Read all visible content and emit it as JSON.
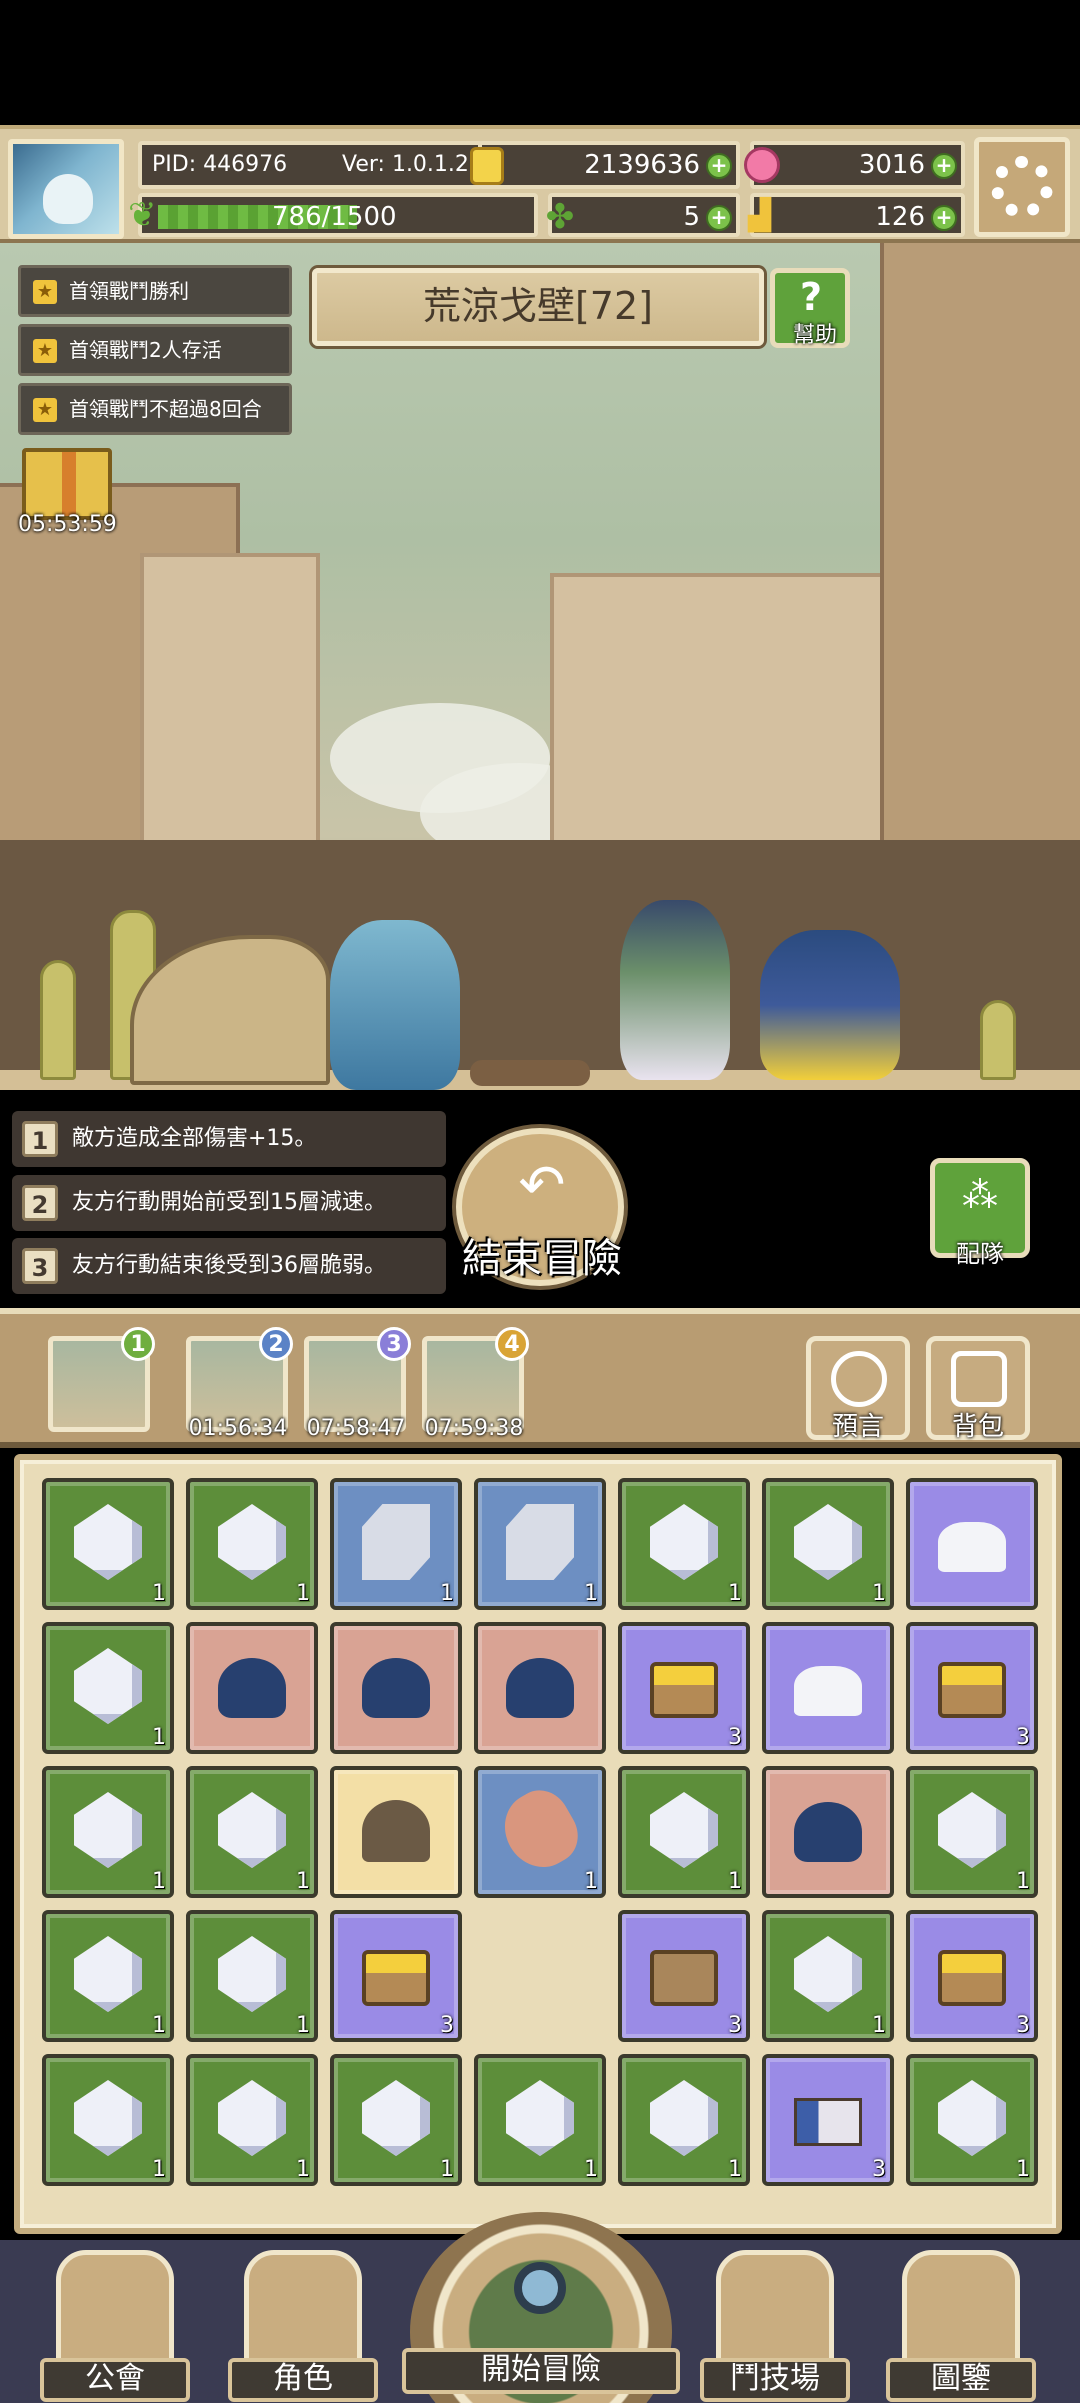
{
  "header": {
    "pid": "PID: 446976",
    "version": "Ver: 1.0.1.2",
    "gold": "2139636",
    "gems": "3016",
    "exp": "786/1500",
    "exp_fraction": 0.524,
    "clovers": "5",
    "shoes": "126"
  },
  "quests": [
    {
      "label": "首領戰鬥勝利"
    },
    {
      "label": "首領戰鬥2人存活"
    },
    {
      "label": "首領戰鬥不超過8回合"
    }
  ],
  "gift": {
    "timer": "05:53:59"
  },
  "stage": {
    "title": "荒涼戈壁[72]",
    "help_label": "幫助"
  },
  "effects": [
    {
      "num": "1",
      "text": "敵方造成全部傷害+15。"
    },
    {
      "num": "2",
      "text": "友方行動開始前受到15層減速。"
    },
    {
      "num": "3",
      "text": "友方行動結束後受到36層脆弱。"
    }
  ],
  "end_button": {
    "label": "結束冒險"
  },
  "team_button": {
    "label": "配隊"
  },
  "slots": [
    {
      "num": "1",
      "time": "",
      "color": "#6fae3f"
    },
    {
      "num": "2",
      "time": "01:56:34",
      "color": "#5b82c6"
    },
    {
      "num": "3",
      "time": "07:58:47",
      "color": "#8a7ed8"
    },
    {
      "num": "4",
      "time": "07:59:38",
      "color": "#d9a436"
    }
  ],
  "side_buttons": {
    "prophecy": "預言",
    "backpack": "背包"
  },
  "inventory": [
    {
      "type": "crystal",
      "rarity": "green",
      "qty": "1"
    },
    {
      "type": "crystal",
      "rarity": "green",
      "qty": "1"
    },
    {
      "type": "cube",
      "rarity": "blue",
      "qty": "1"
    },
    {
      "type": "cube",
      "rarity": "blue",
      "qty": "1"
    },
    {
      "type": "crystal",
      "rarity": "green",
      "qty": "1"
    },
    {
      "type": "crystal",
      "rarity": "green",
      "qty": "1"
    },
    {
      "type": "ore",
      "rarity": "purple",
      "qty": ""
    },
    {
      "type": "crystal",
      "rarity": "green",
      "qty": "1"
    },
    {
      "type": "slime",
      "rarity": "pink",
      "qty": ""
    },
    {
      "type": "slime",
      "rarity": "pink",
      "qty": ""
    },
    {
      "type": "slime",
      "rarity": "pink",
      "qty": ""
    },
    {
      "type": "gold-chest",
      "rarity": "purple",
      "qty": "3"
    },
    {
      "type": "ore",
      "rarity": "purple",
      "qty": ""
    },
    {
      "type": "gold-chest",
      "rarity": "purple",
      "qty": "3"
    },
    {
      "type": "crystal",
      "rarity": "green",
      "qty": "1"
    },
    {
      "type": "crystal",
      "rarity": "green",
      "qty": "1"
    },
    {
      "type": "pot",
      "rarity": "cream",
      "qty": ""
    },
    {
      "type": "meat",
      "rarity": "blue",
      "qty": "1"
    },
    {
      "type": "crystal",
      "rarity": "green",
      "qty": "1"
    },
    {
      "type": "slime",
      "rarity": "pink",
      "qty": ""
    },
    {
      "type": "crystal",
      "rarity": "green",
      "qty": "1"
    },
    {
      "type": "crystal",
      "rarity": "green",
      "qty": "1"
    },
    {
      "type": "crystal",
      "rarity": "green",
      "qty": "1"
    },
    {
      "type": "gold-chest",
      "rarity": "purple",
      "qty": "3"
    },
    {
      "type": "empty",
      "rarity": "empty",
      "qty": ""
    },
    {
      "type": "chest",
      "rarity": "purple",
      "qty": "3"
    },
    {
      "type": "crystal",
      "rarity": "green",
      "qty": "1"
    },
    {
      "type": "gold-chest",
      "rarity": "purple",
      "qty": "3"
    },
    {
      "type": "crystal",
      "rarity": "green",
      "qty": "1"
    },
    {
      "type": "crystal",
      "rarity": "green",
      "qty": "1"
    },
    {
      "type": "crystal",
      "rarity": "green",
      "qty": "1"
    },
    {
      "type": "crystal",
      "rarity": "green",
      "qty": "1"
    },
    {
      "type": "crystal",
      "rarity": "green",
      "qty": "1"
    },
    {
      "type": "flag",
      "rarity": "purple",
      "qty": "3"
    },
    {
      "type": "crystal",
      "rarity": "green",
      "qty": "1"
    }
  ],
  "nav": {
    "guild": "公會",
    "character": "角色",
    "adventure": "開始冒險",
    "arena": "鬥技場",
    "codex": "圖鑒"
  }
}
